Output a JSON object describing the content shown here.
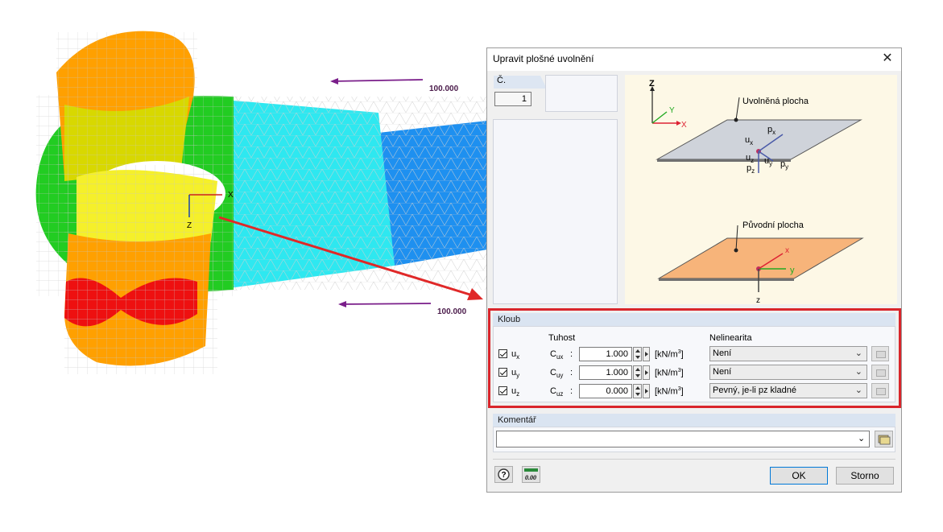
{
  "scene": {
    "load_labels": [
      "100.000",
      "100.000"
    ],
    "axis_x": "X",
    "axis_z": "Z",
    "mesh_colors": [
      "#ffa000",
      "#d8d800",
      "#22cc22",
      "#2ee8f0",
      "#1e90f0",
      "#ee1010"
    ]
  },
  "dialog": {
    "title": "Upravit plošné uvolnění",
    "close_icon": "close-icon",
    "no_label": "Č.",
    "no_value": "1",
    "diagram": {
      "released_surface_label": "Uvolněná plocha",
      "original_surface_label": "Původní plocha",
      "axes": {
        "z": "Z",
        "y": "Y",
        "x": "X",
        "lx": "x",
        "ly": "y",
        "lz": "z"
      },
      "sym_ux": "u",
      "sub_x": "x",
      "sym_px": "p",
      "sym_uz": "u",
      "sub_z": "z",
      "sym_uy": "u",
      "sub_y": "y",
      "sym_py": "p",
      "sym_pz": "p"
    },
    "hinge": {
      "header": "Kloub",
      "stiffness_label": "Tuhost",
      "nonlinearity_label": "Nelinearita",
      "rows": [
        {
          "dof": "u",
          "dof_sub": "x",
          "coef": "C",
          "coef_sub": "ux",
          "colon": ":",
          "value": "1.000",
          "unit_pre": "[kN/m",
          "unit_sup": "3",
          "unit_post": "]",
          "nonlinearity": "Není",
          "checked": true
        },
        {
          "dof": "u",
          "dof_sub": "y",
          "coef": "C",
          "coef_sub": "uy",
          "colon": ":",
          "value": "1.000",
          "unit_pre": "[kN/m",
          "unit_sup": "3",
          "unit_post": "]",
          "nonlinearity": "Není",
          "checked": true
        },
        {
          "dof": "u",
          "dof_sub": "z",
          "coef": "C",
          "coef_sub": "uz",
          "colon": ":",
          "value": "0.000",
          "unit_pre": "[kN/m",
          "unit_sup": "3",
          "unit_post": "]",
          "nonlinearity": "Pevný, je-li pz kladné",
          "checked": true
        }
      ],
      "highlight_color": "#d9252b"
    },
    "comment": {
      "header": "Komentář",
      "value": ""
    },
    "buttons": {
      "ok": "OK",
      "cancel": "Storno",
      "units_icon_text": "0.00"
    }
  }
}
